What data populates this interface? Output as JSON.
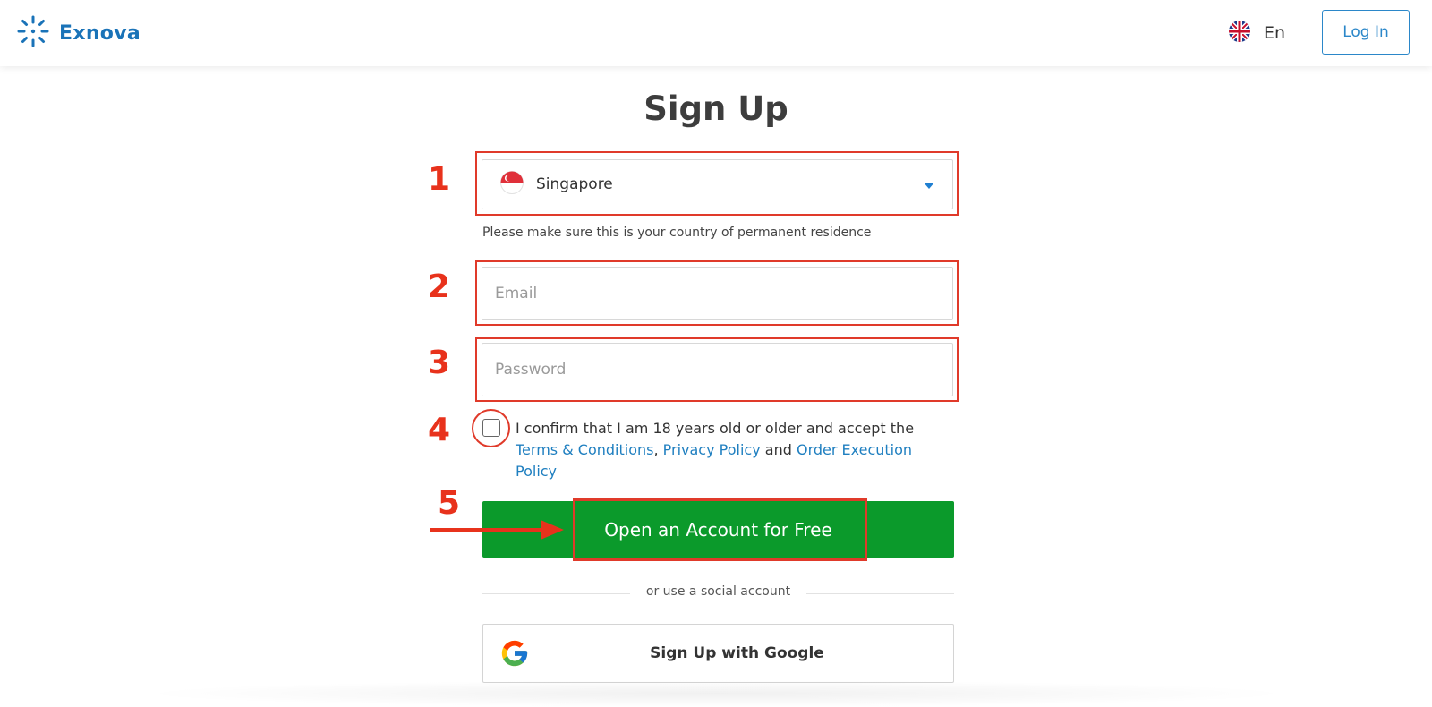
{
  "header": {
    "logo_text": "Exnova",
    "language_label": "En",
    "login_label": "Log In"
  },
  "page": {
    "title": "Sign Up"
  },
  "form": {
    "country": {
      "value": "Singapore",
      "hint": "Please make sure this is your country of permanent residence"
    },
    "email": {
      "placeholder": "Email"
    },
    "password": {
      "placeholder": "Password"
    },
    "consent": {
      "text_prefix": "I confirm that I am 18 years old or older and accept the",
      "link_terms": "Terms & Conditions",
      "separator": ",",
      "link_privacy": "Privacy Policy",
      "conjunction": "and",
      "link_order": "Order Execution Policy"
    },
    "submit_label": "Open an Account for Free",
    "social_divider": "or use a social account",
    "google_label": "Sign Up with Google"
  },
  "annotations": {
    "step_1": "1",
    "step_2": "2",
    "step_3": "3",
    "step_4": "4",
    "step_5": "5"
  },
  "colors": {
    "brand_blue": "#1a73b8",
    "primary_green": "#0b9a2b",
    "annotation_red": "#e03a2a",
    "link_blue": "#1f7fc0"
  },
  "icons": {
    "logo": "exnova-logo-icon",
    "language_flag": "uk-flag-icon",
    "country_flag": "singapore-flag-icon",
    "dropdown": "chevron-down-icon",
    "google": "google-icon",
    "pointer_arrow": "arrow-right-icon"
  }
}
